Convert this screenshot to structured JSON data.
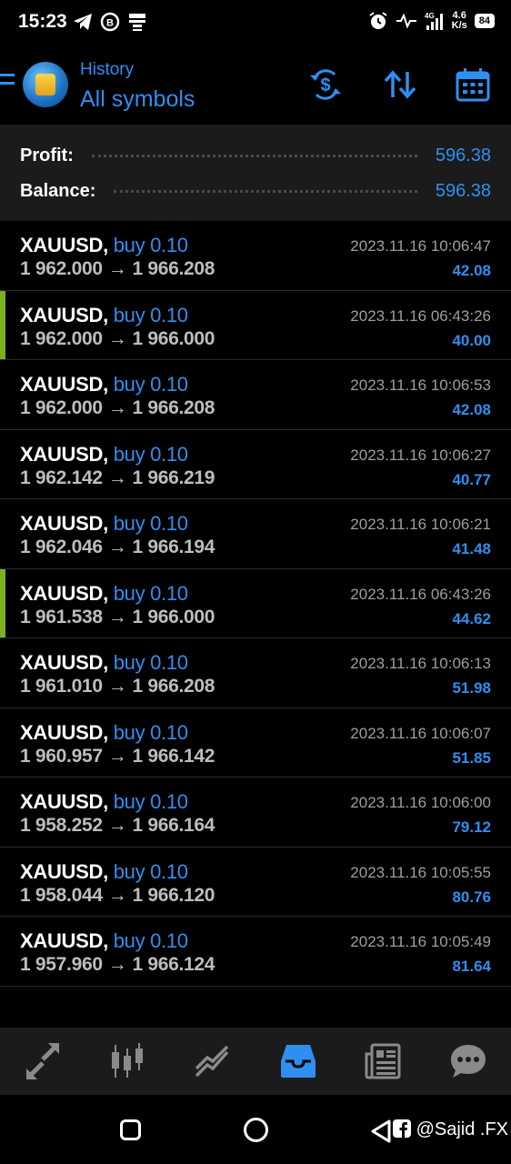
{
  "status_bar": {
    "time": "15:23",
    "speed_top": "4.6",
    "speed_bottom": "K/s",
    "battery": "84",
    "network": "4G"
  },
  "header": {
    "title": "History",
    "subtitle": "All symbols"
  },
  "summary": {
    "profit_label": "Profit:",
    "profit_value": "596.38",
    "balance_label": "Balance:",
    "balance_value": "596.38"
  },
  "deals": [
    {
      "symbol": "XAUUSD,",
      "type": "buy 0.10",
      "open": "1 962.000",
      "close": "1 966.208",
      "time": "2023.11.16 10:06:47",
      "profit": "42.08",
      "marked": false
    },
    {
      "symbol": "XAUUSD,",
      "type": "buy 0.10",
      "open": "1 962.000",
      "close": "1 966.000",
      "time": "2023.11.16 06:43:26",
      "profit": "40.00",
      "marked": true
    },
    {
      "symbol": "XAUUSD,",
      "type": "buy 0.10",
      "open": "1 962.000",
      "close": "1 966.208",
      "time": "2023.11.16 10:06:53",
      "profit": "42.08",
      "marked": false
    },
    {
      "symbol": "XAUUSD,",
      "type": "buy 0.10",
      "open": "1 962.142",
      "close": "1 966.219",
      "time": "2023.11.16 10:06:27",
      "profit": "40.77",
      "marked": false
    },
    {
      "symbol": "XAUUSD,",
      "type": "buy 0.10",
      "open": "1 962.046",
      "close": "1 966.194",
      "time": "2023.11.16 10:06:21",
      "profit": "41.48",
      "marked": false
    },
    {
      "symbol": "XAUUSD,",
      "type": "buy 0.10",
      "open": "1 961.538",
      "close": "1 966.000",
      "time": "2023.11.16 06:43:26",
      "profit": "44.62",
      "marked": true
    },
    {
      "symbol": "XAUUSD,",
      "type": "buy 0.10",
      "open": "1 961.010",
      "close": "1 966.208",
      "time": "2023.11.16 10:06:13",
      "profit": "51.98",
      "marked": false
    },
    {
      "symbol": "XAUUSD,",
      "type": "buy 0.10",
      "open": "1 960.957",
      "close": "1 966.142",
      "time": "2023.11.16 10:06:07",
      "profit": "51.85",
      "marked": false
    },
    {
      "symbol": "XAUUSD,",
      "type": "buy 0.10",
      "open": "1 958.252",
      "close": "1 966.164",
      "time": "2023.11.16 10:06:00",
      "profit": "79.12",
      "marked": false
    },
    {
      "symbol": "XAUUSD,",
      "type": "buy 0.10",
      "open": "1 958.044",
      "close": "1 966.120",
      "time": "2023.11.16 10:05:55",
      "profit": "80.76",
      "marked": false
    },
    {
      "symbol": "XAUUSD,",
      "type": "buy 0.10",
      "open": "1 957.960",
      "close": "1 966.124",
      "time": "2023.11.16 10:05:49",
      "profit": "81.64",
      "marked": false
    }
  ],
  "deal_arrow": "→",
  "bottom_nav": {
    "items": [
      "quotes-icon",
      "chart-icon",
      "trade-icon",
      "history-icon",
      "news-icon",
      "chat-icon"
    ],
    "active": "history-icon"
  },
  "watermark": "@Sajid .FX",
  "colors": {
    "accent": "#2f8ff0",
    "marker": "#7bb01e",
    "background": "#000000",
    "panel": "#1b1b1b"
  }
}
